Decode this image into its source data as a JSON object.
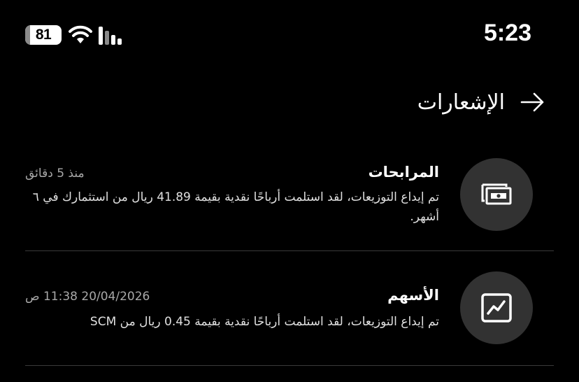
{
  "status_bar": {
    "battery_level": "81",
    "time": "5:23"
  },
  "header": {
    "title": "الإشعارات",
    "back_icon": "arrow-right-icon"
  },
  "notifications": [
    {
      "title": "المرابحات",
      "time": "منذ 5 دقائق",
      "body": "تم إيداع التوزيعات، لقد استلمت أرباحًا نقدية بقيمة 41.89 ريال من استثمارك في ٦ أشهر.",
      "icon": "cash-icon"
    },
    {
      "title": "الأسهم",
      "time": "20/04/2026 11:38 ص",
      "body": "تم إيداع التوزيعات، لقد استلمت أرباحًا نقدية بقيمة 0.45 ريال من SCM",
      "icon": "stock-chart-icon"
    }
  ],
  "colors": {
    "background": "#000000",
    "icon_circle": "#323232",
    "divider": "#3a3a3a",
    "muted_text": "#a8a8a8"
  }
}
